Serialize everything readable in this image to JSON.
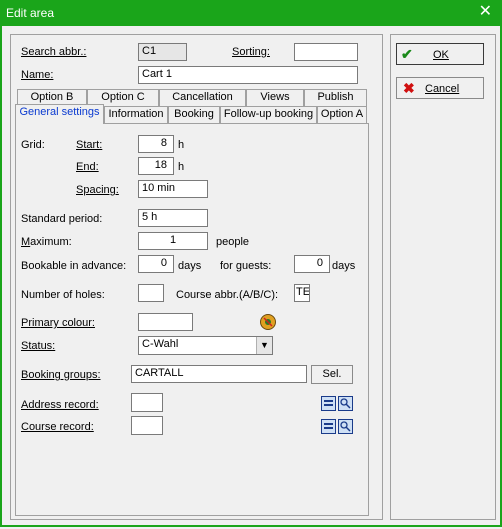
{
  "window": {
    "title": "Edit area"
  },
  "header": {
    "search_label": "Search abbr.:",
    "search_value": "C1",
    "sorting_label": "Sorting:",
    "sorting_value": "",
    "name_label": "Name:",
    "name_value": "Cart 1"
  },
  "tabs_row1": [
    "Option B",
    "Option C",
    "Cancellation",
    "Views",
    "Publish"
  ],
  "tabs_row2": [
    "General settings",
    "Information",
    "Booking",
    "Follow-up booking",
    "Option A"
  ],
  "general": {
    "grid_label": "Grid:",
    "start_label": "Start:",
    "start_value": "8",
    "end_label": "End:",
    "end_value": "18",
    "hour_unit": "h",
    "spacing_label": "Spacing:",
    "spacing_value": "10 min",
    "standard_period_label": "Standard period:",
    "standard_period_value": "5 h",
    "maximum_label": "Maximum:",
    "maximum_value": "1",
    "people_unit": "people",
    "bookable_label": "Bookable in advance:",
    "bookable_value": "0",
    "days_unit": "days",
    "guests_label": "for guests:",
    "guests_value": "0",
    "holes_label": "Number of holes:",
    "holes_value": "",
    "course_abbr_label": "Course abbr.(A/B/C):",
    "course_abbr_value": "TE",
    "primary_colour_label": "Primary colour:",
    "primary_colour_value": "",
    "status_label": "Status:",
    "status_value": "C-Wahl",
    "booking_groups_label": "Booking groups:",
    "booking_groups_value": "CARTALL",
    "sel_button": "Sel.",
    "address_record_label": "Address record:",
    "address_record_value": "",
    "course_record_label": "Course record:",
    "course_record_value": ""
  },
  "actions": {
    "ok": "OK",
    "cancel": "Cancel"
  },
  "colors": {
    "title_bar": "#1aa51a",
    "ok_check": "#1a8a1a",
    "cancel_x": "#d01010",
    "active_tab_text": "#0a3ad0"
  },
  "icons": [
    "close-icon",
    "check-icon",
    "x-icon",
    "color-picker-icon",
    "list-icon",
    "search-icon"
  ]
}
